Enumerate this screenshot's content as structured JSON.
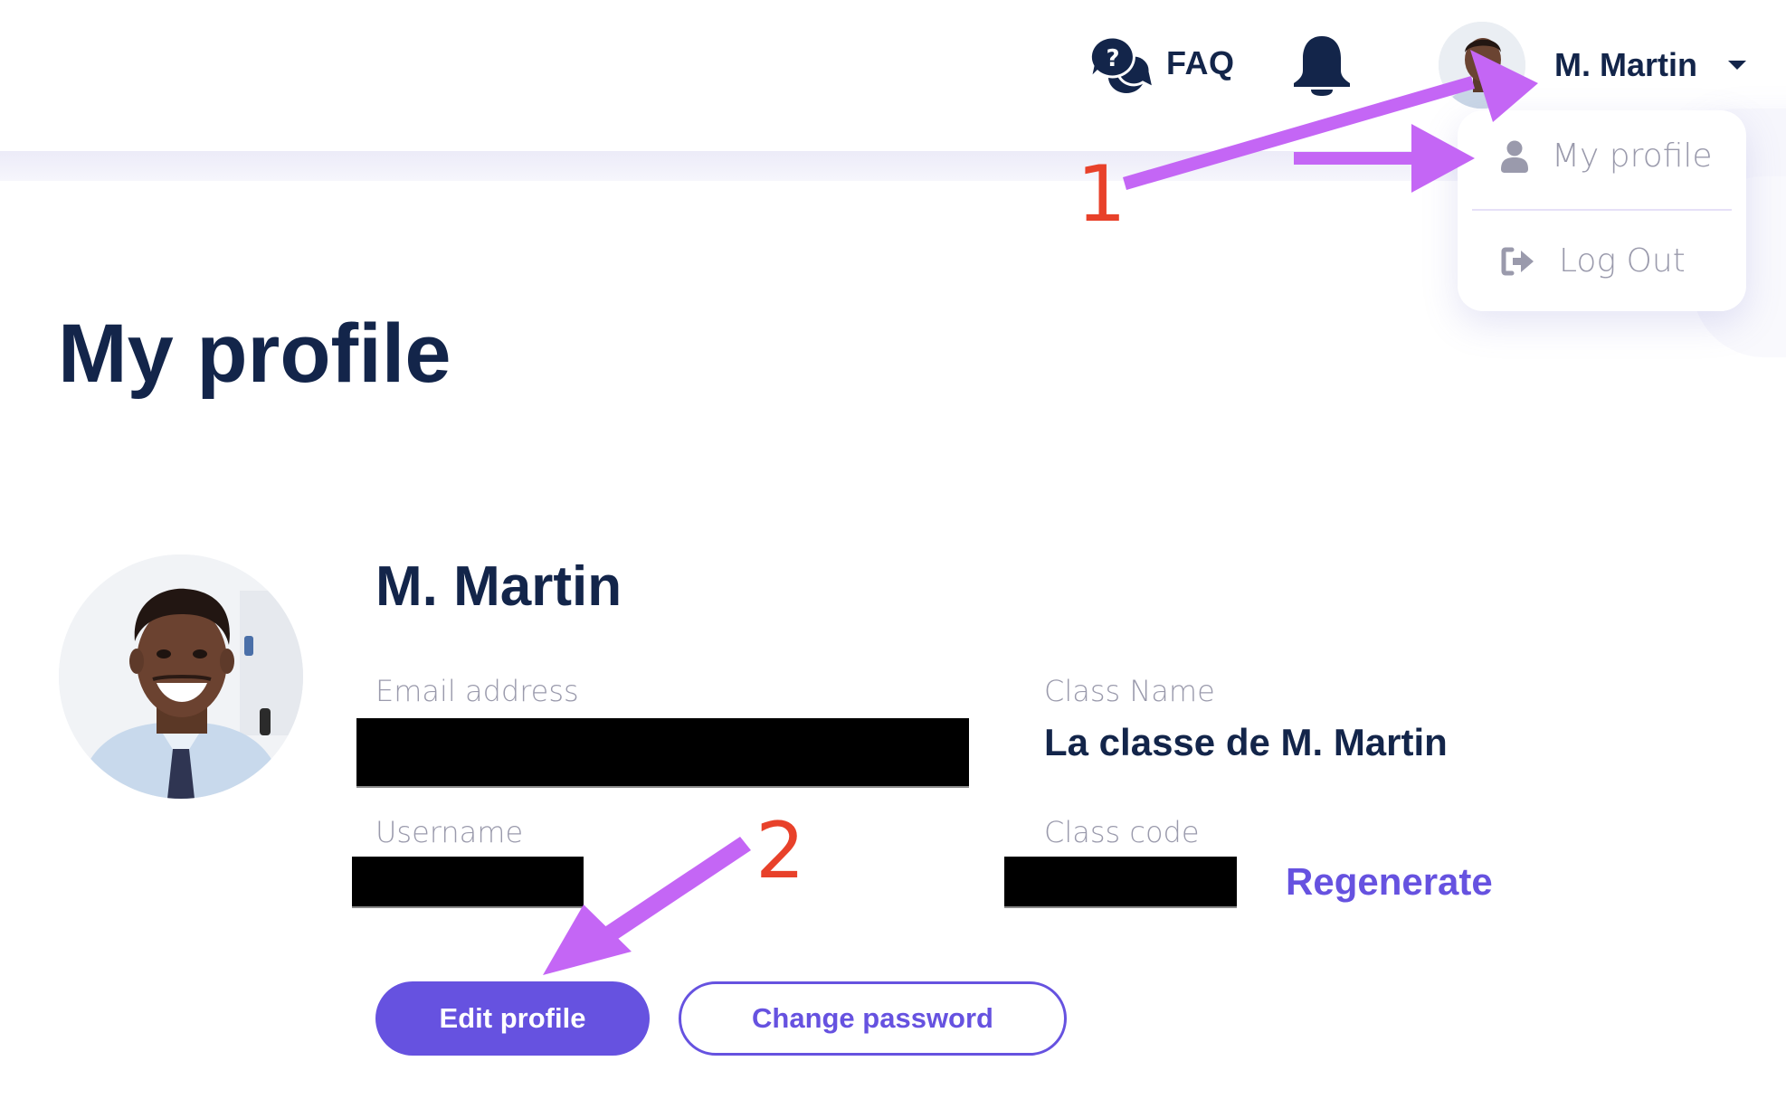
{
  "header": {
    "faq_label": "FAQ",
    "faq_icon": "question-chat-bubbles-icon",
    "notifications_icon": "bell-icon",
    "user": {
      "name": "M. Martin",
      "avatar": "user-photo",
      "caret_icon": "caret-down-icon"
    }
  },
  "user_dropdown": {
    "items": [
      {
        "label": "My profile",
        "icon": "user-icon"
      },
      {
        "label": "Log Out",
        "icon": "sign-out-icon"
      }
    ]
  },
  "page": {
    "title": "My profile"
  },
  "profile": {
    "name": "M. Martin",
    "fields": {
      "email": {
        "label": "Email address",
        "value": "[redacted]"
      },
      "class_name": {
        "label": "Class Name",
        "value": "La classe de M. Martin"
      },
      "username": {
        "label": "Username",
        "value": "[redacted]"
      },
      "class_code": {
        "label": "Class code",
        "value": "[redacted]"
      }
    },
    "regenerate_label": "Regenerate",
    "buttons": {
      "edit": "Edit profile",
      "change_password": "Change password"
    }
  },
  "annotations": {
    "step_1": "1",
    "step_2": "2",
    "arrow_color": "#c466f5",
    "number_color": "#e8412a"
  },
  "colors": {
    "primary": "#6652e0",
    "text_dark": "#13254a",
    "text_muted": "#9a9aac"
  }
}
